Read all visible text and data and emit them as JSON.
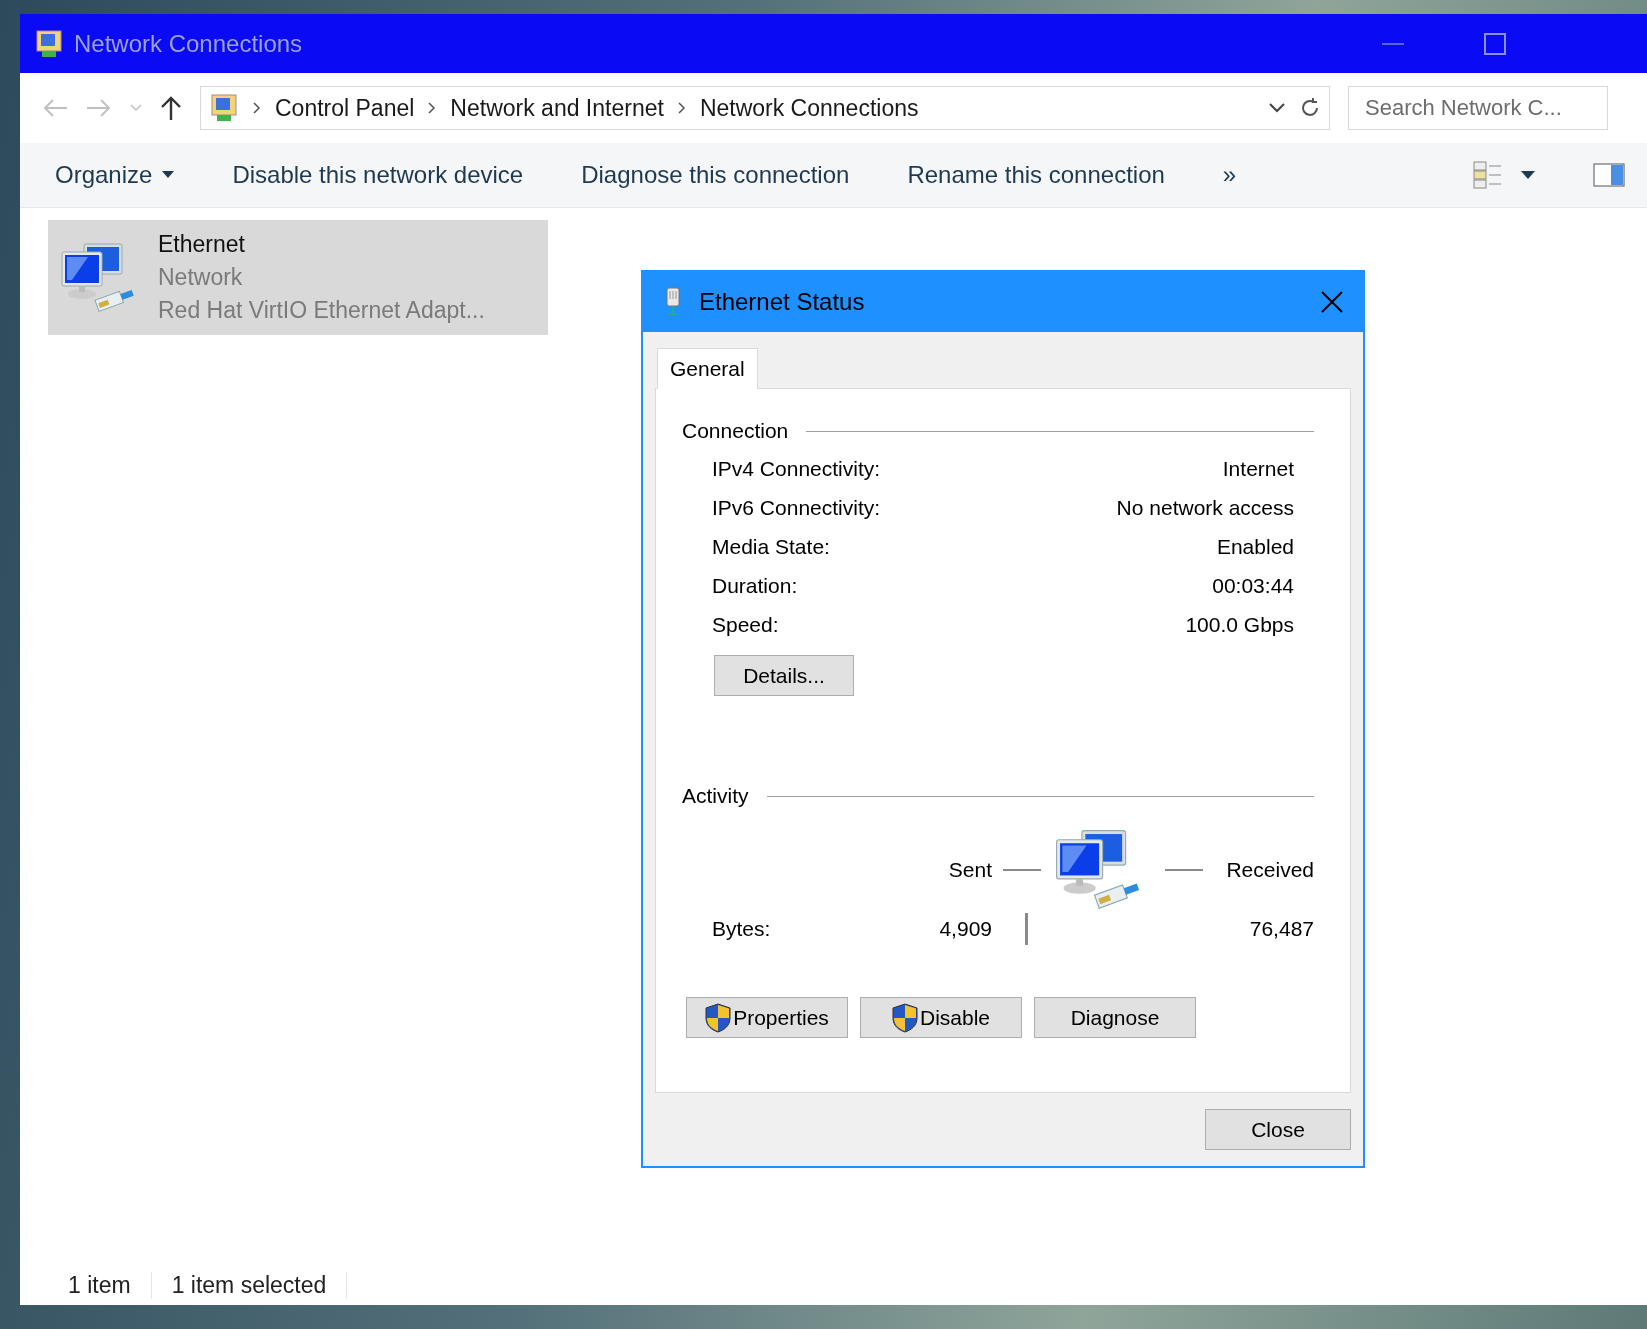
{
  "window": {
    "title": "Network Connections"
  },
  "address_bar": {
    "breadcrumbs": [
      "Control Panel",
      "Network and Internet",
      "Network Connections"
    ]
  },
  "search": {
    "placeholder": "Search Network C..."
  },
  "command_bar": {
    "items": [
      {
        "label": "Organize",
        "kind": "menu"
      },
      {
        "label": "Disable this network device",
        "kind": "button"
      },
      {
        "label": "Diagnose this connection",
        "kind": "button"
      },
      {
        "label": "Rename this connection",
        "kind": "button"
      }
    ],
    "more": "»"
  },
  "connections": [
    {
      "name": "Ethernet",
      "network": "Network",
      "adapter": "Red Hat VirtIO Ethernet Adapt...",
      "selected": true
    }
  ],
  "dialog": {
    "title": "Ethernet Status",
    "tabs": [
      {
        "label": "General",
        "selected": true
      }
    ],
    "connection": {
      "heading": "Connection",
      "rows": [
        {
          "label": "IPv4 Connectivity:",
          "value": "Internet"
        },
        {
          "label": "IPv6 Connectivity:",
          "value": "No network access"
        },
        {
          "label": "Media State:",
          "value": "Enabled"
        },
        {
          "label": "Duration:",
          "value": "00:03:44"
        },
        {
          "label": "Speed:",
          "value": "100.0 Gbps"
        }
      ],
      "details_button": "Details..."
    },
    "activity": {
      "heading": "Activity",
      "sent_label": "Sent",
      "received_label": "Received",
      "bytes_label": "Bytes:",
      "sent": "4,909",
      "received": "76,487"
    },
    "buttons": [
      {
        "label": "Properties",
        "shield": true
      },
      {
        "label": "Disable",
        "shield": true
      },
      {
        "label": "Diagnose",
        "shield": false
      }
    ],
    "close_button": "Close"
  },
  "status_bar": {
    "items": [
      "1 item",
      "1 item selected"
    ]
  }
}
